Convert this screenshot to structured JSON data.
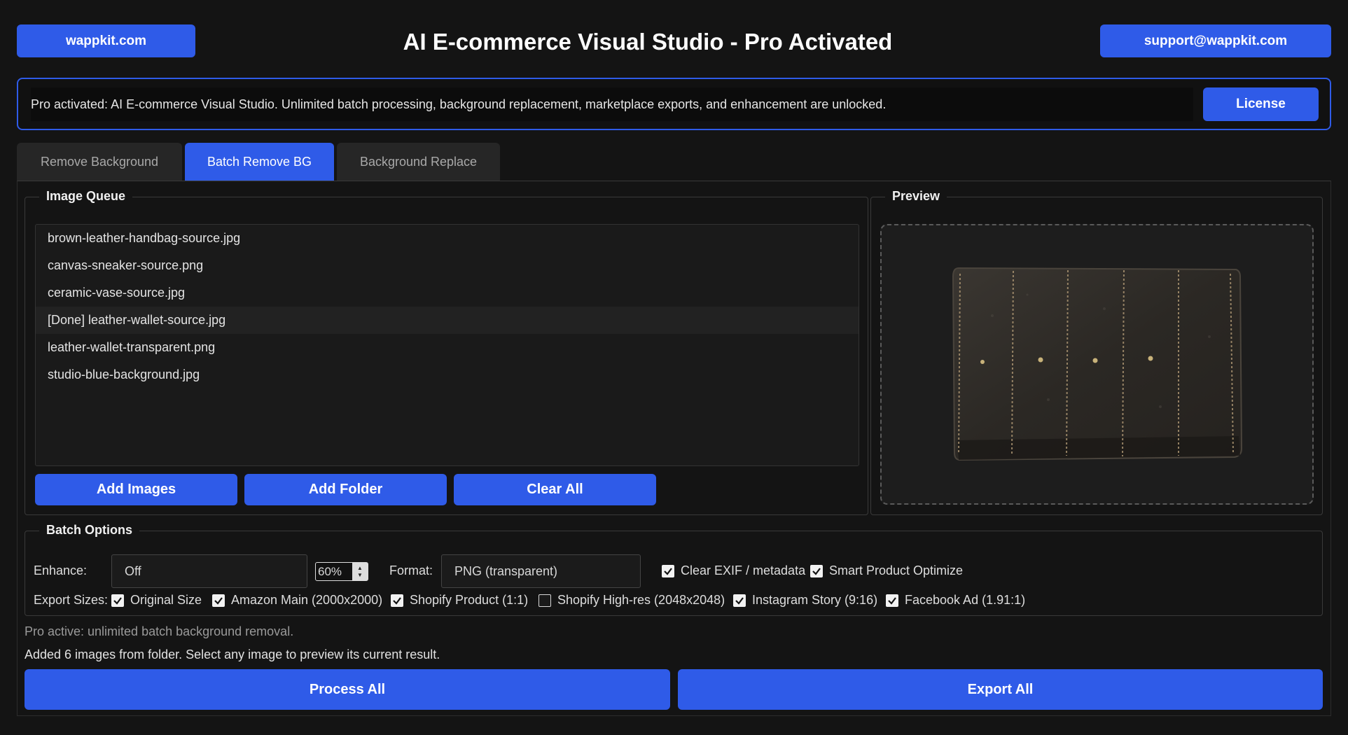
{
  "header": {
    "site_label": "wappkit.com",
    "title": "AI E-commerce Visual Studio - Pro Activated",
    "support_label": "support@wappkit.com"
  },
  "banner": {
    "message": "Pro activated: AI E-commerce Visual Studio. Unlimited batch processing, background replacement, marketplace exports, and enhancement are unlocked.",
    "license_label": "License"
  },
  "tabs": [
    {
      "label": "Remove Background",
      "active": false
    },
    {
      "label": "Batch Remove BG",
      "active": true
    },
    {
      "label": "Background Replace",
      "active": false
    }
  ],
  "queue": {
    "title": "Image Queue",
    "items": [
      "brown-leather-handbag-source.jpg",
      "canvas-sneaker-source.png",
      "ceramic-vase-source.jpg",
      "[Done] leather-wallet-source.jpg",
      "leather-wallet-transparent.png",
      "studio-blue-background.jpg"
    ],
    "selected_index": 3,
    "add_images_label": "Add Images",
    "add_folder_label": "Add Folder",
    "clear_all_label": "Clear All"
  },
  "preview": {
    "title": "Preview",
    "image_subject": "leather-wallet"
  },
  "batch_options": {
    "title": "Batch Options",
    "enhance_label": "Enhance:",
    "enhance_value": "Off",
    "strength_value": "60%",
    "format_label": "Format:",
    "format_value": "PNG (transparent)",
    "clear_exif_label": "Clear EXIF / metadata",
    "clear_exif_checked": true,
    "smart_optimize_label": "Smart Product Optimize",
    "smart_optimize_checked": true,
    "export_sizes_label": "Export Sizes:",
    "export_sizes": [
      {
        "label": "Original Size",
        "checked": true
      },
      {
        "label": "Amazon Main (2000x2000)",
        "checked": true
      },
      {
        "label": "Shopify Product (1:1)",
        "checked": true
      },
      {
        "label": "Shopify High-res (2048x2048)",
        "checked": false
      },
      {
        "label": "Instagram Story (9:16)",
        "checked": true
      },
      {
        "label": "Facebook Ad (1.91:1)",
        "checked": true
      }
    ]
  },
  "status": {
    "line1": "Pro active: unlimited batch background removal.",
    "line2": "Added 6 images from folder. Select any image to preview its current result."
  },
  "actions": {
    "process_all_label": "Process All",
    "export_all_label": "Export All"
  },
  "colors": {
    "accent": "#2f5be8",
    "background": "#141414"
  }
}
